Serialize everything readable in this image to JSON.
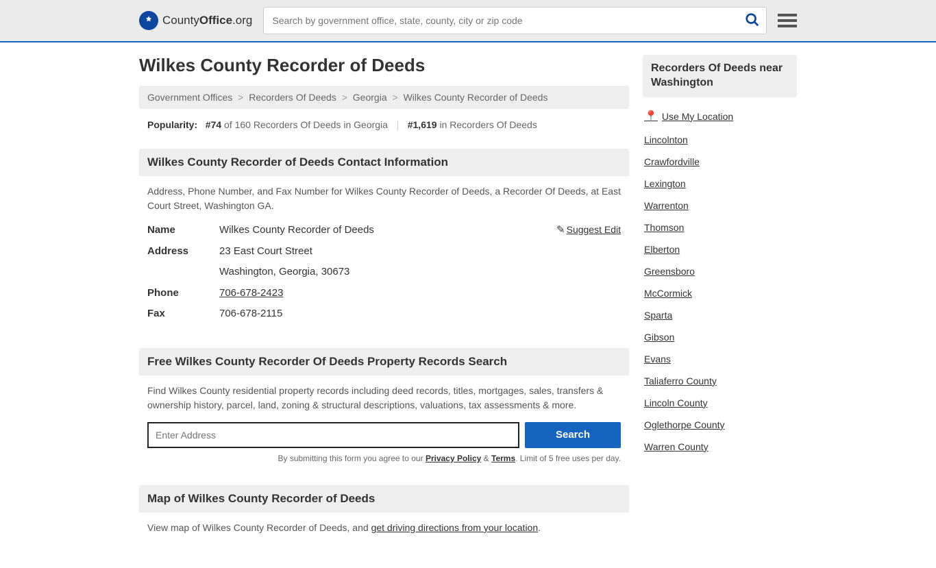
{
  "logo": {
    "prefix": "County",
    "bold": "Office",
    "suffix": ".org"
  },
  "search": {
    "placeholder": "Search by government office, state, county, city or zip code"
  },
  "page_title": "Wilkes County Recorder of Deeds",
  "breadcrumb": {
    "items": [
      "Government Offices",
      "Recorders Of Deeds",
      "Georgia",
      "Wilkes County Recorder of Deeds"
    ]
  },
  "popularity": {
    "label": "Popularity:",
    "rank1_num": "#74",
    "rank1_rest": " of 160 Recorders Of Deeds in Georgia",
    "rank2_num": "#1,619",
    "rank2_rest": " in Recorders Of Deeds"
  },
  "contact": {
    "heading": "Wilkes County Recorder of Deeds Contact Information",
    "description": "Address, Phone Number, and Fax Number for Wilkes County Recorder of Deeds, a Recorder Of Deeds, at East Court Street, Washington GA.",
    "suggest_edit": "Suggest Edit",
    "name_label": "Name",
    "name_value": "Wilkes County Recorder of Deeds",
    "address_label": "Address",
    "address_line1": "23 East Court Street",
    "address_line2": "Washington, Georgia, 30673",
    "phone_label": "Phone",
    "phone_value": "706-678-2423",
    "fax_label": "Fax",
    "fax_value": "706-678-2115"
  },
  "records_search": {
    "heading": "Free Wilkes County Recorder Of Deeds Property Records Search",
    "description": "Find Wilkes County residential property records including deed records, titles, mortgages, sales, transfers & ownership history, parcel, land, zoning & structural descriptions, valuations, tax assessments & more.",
    "input_placeholder": "Enter Address",
    "button": "Search",
    "disclaimer_pre": "By submitting this form you agree to our ",
    "privacy": "Privacy Policy",
    "amp": " & ",
    "terms": "Terms",
    "disclaimer_post": ". Limit of 5 free uses per day."
  },
  "map": {
    "heading": "Map of Wilkes County Recorder of Deeds",
    "text_pre": "View map of Wilkes County Recorder of Deeds, and ",
    "link": "get driving directions from your location",
    "text_post": "."
  },
  "sidebar": {
    "heading": "Recorders Of Deeds near Washington",
    "use_location": "Use My Location",
    "items": [
      "Lincolnton",
      "Crawfordville",
      "Lexington",
      "Warrenton",
      "Thomson",
      "Elberton",
      "Greensboro",
      "McCormick",
      "Sparta",
      "Gibson",
      "Evans",
      "Taliaferro County",
      "Lincoln County",
      "Oglethorpe County",
      "Warren County"
    ]
  }
}
